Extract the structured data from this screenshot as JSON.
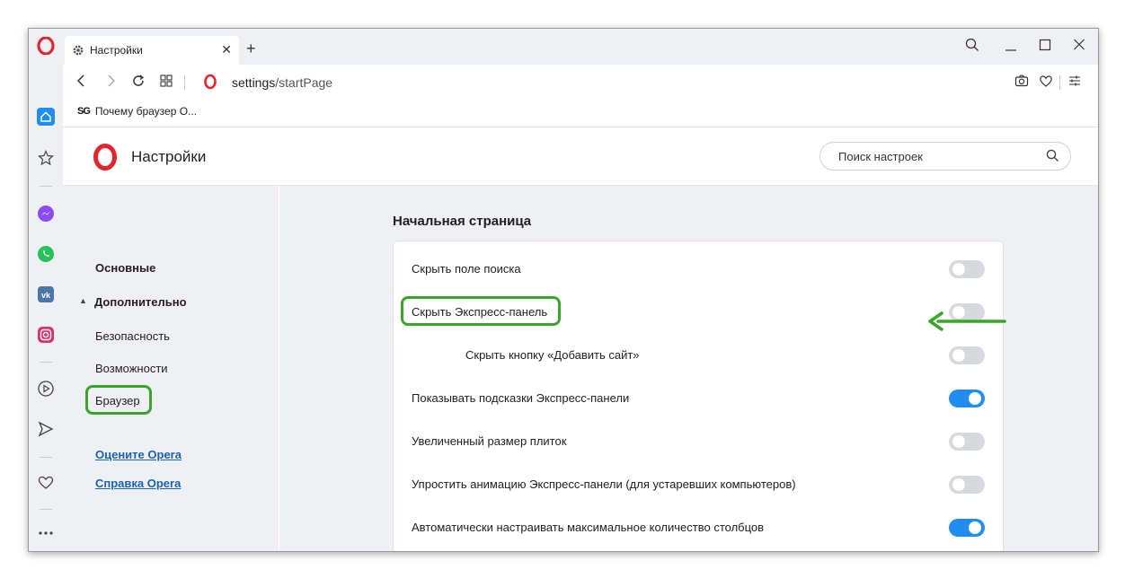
{
  "tab": {
    "title": "Настройки"
  },
  "address": {
    "host": "settings",
    "path": "/startPage"
  },
  "bookmark": {
    "badge": "SG",
    "label": "Почему браузер О..."
  },
  "header": {
    "title": "Настройки",
    "search_placeholder": "Поиск настроек"
  },
  "nav": {
    "basic": "Основные",
    "advanced": "Дополнительно",
    "security": "Безопасность",
    "features": "Возможности",
    "browser": "Браузер",
    "rate": "Оцените Opera",
    "help": "Справка Opera"
  },
  "section": {
    "title": "Начальная страница"
  },
  "settings": [
    {
      "label": "Скрыть поле поиска",
      "on": false
    },
    {
      "label": "Скрыть Экспресс-панель",
      "on": false
    },
    {
      "label": "Скрыть кнопку «Добавить сайт»",
      "on": false
    },
    {
      "label": "Показывать подсказки Экспресс-панели",
      "on": true
    },
    {
      "label": "Увеличенный размер плиток",
      "on": false
    },
    {
      "label": "Упростить анимацию Экспресс-панели (для устаревших компьютеров)",
      "on": false
    },
    {
      "label": "Автоматически настраивать максимальное количество столбцов",
      "on": true
    }
  ],
  "colors": {
    "accent": "#1f8ef0",
    "highlight": "#3aa52b",
    "opera_red": "#e3262d"
  }
}
